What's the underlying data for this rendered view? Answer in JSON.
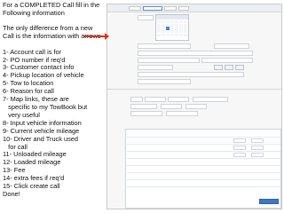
{
  "instructions": {
    "intro_lines": [
      "For a COMPLETED Call fill in the",
      "Following information"
    ],
    "diff_lines": [
      "The only difference from a new",
      "Call is the information with arrows"
    ],
    "steps": [
      "1- Account call is for",
      "2- PO number if req'd",
      "3- Customer contact info",
      "4- Pickup location of vehicle",
      "5- Tow to location",
      "6- Reason for call",
      "7- Map links, these are",
      "   specific to my TowBook but",
      "   very useful",
      "8- Input vehicle information",
      "9- Current vehicle mileage",
      "10- Driver and Truck used",
      "   for call",
      "11- Unloaded mileage",
      "12- Loaded mileage",
      "13- Fee",
      "14- extra fees if req'd",
      "15- Click create call",
      "Done!"
    ]
  },
  "colors": {
    "arrow": "#d9331f",
    "accent": "#3d78c2"
  }
}
